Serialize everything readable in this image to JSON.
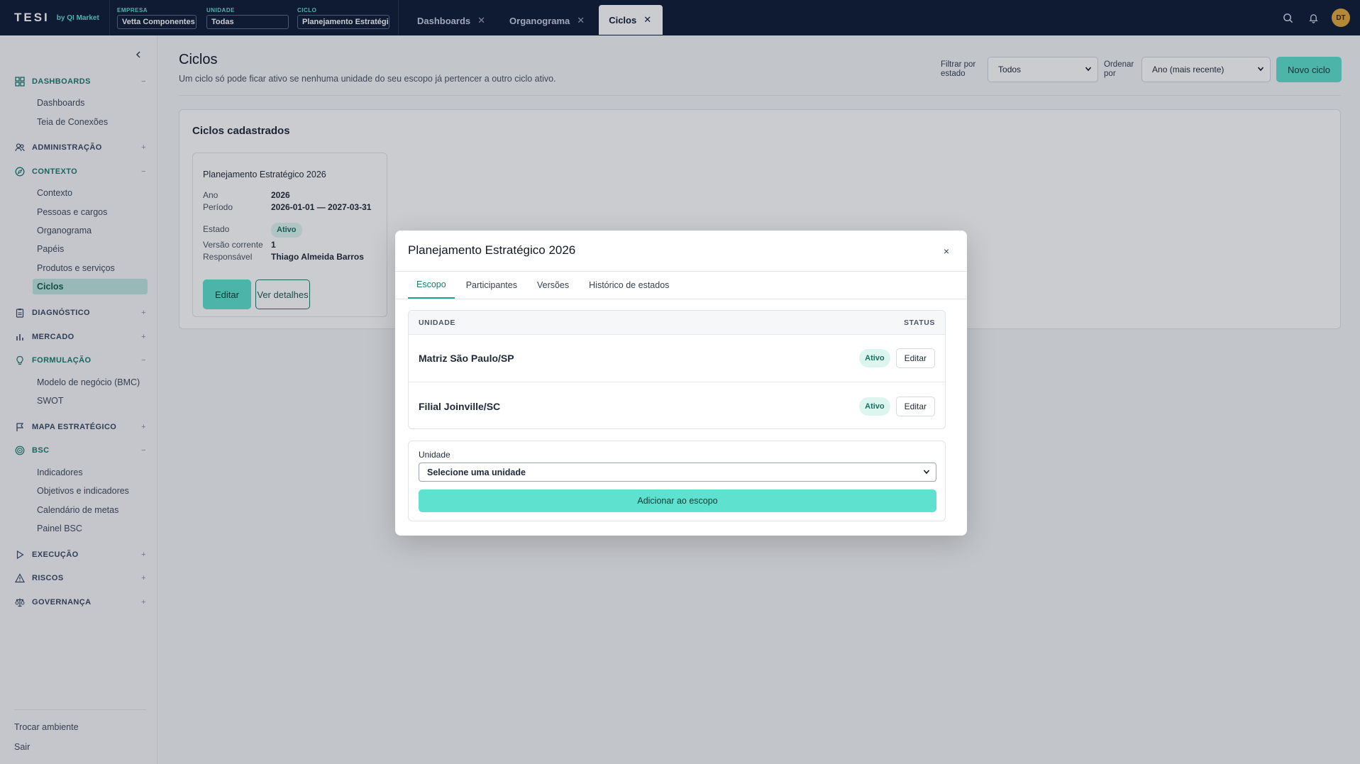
{
  "brand": {
    "logo": "TESI",
    "sub": "by QI Market"
  },
  "context": {
    "empresa": {
      "label": "EMPRESA",
      "value": "Vetta Componentes"
    },
    "unidade": {
      "label": "UNIDADE",
      "value": "Todas"
    },
    "ciclo": {
      "label": "CICLO",
      "value": "Planejamento Estratégi"
    }
  },
  "tabs": [
    {
      "label": "Dashboards"
    },
    {
      "label": "Organograma"
    },
    {
      "label": "Ciclos"
    }
  ],
  "user": {
    "initials": "DT"
  },
  "sidebar": {
    "sections": [
      {
        "label": "DASHBOARDS",
        "sign": "−",
        "items": [
          "Dashboards",
          "Teia de Conexões"
        ]
      },
      {
        "label": "ADMINISTRAÇÃO",
        "sign": "+"
      },
      {
        "label": "CONTEXTO",
        "sign": "−",
        "items": [
          "Contexto",
          "Pessoas e cargos",
          "Organograma",
          "Papéis",
          "Produtos e serviços",
          "Ciclos"
        ]
      },
      {
        "label": "DIAGNÓSTICO",
        "sign": "+"
      },
      {
        "label": "MERCADO",
        "sign": "+"
      },
      {
        "label": "FORMULAÇÃO",
        "sign": "−",
        "items": [
          "Modelo de negócio (BMC)",
          "SWOT"
        ]
      },
      {
        "label": "MAPA ESTRATÉGICO",
        "sign": "+"
      },
      {
        "label": "BSC",
        "sign": "−",
        "items": [
          "Indicadores",
          "Objetivos e indicadores",
          "Calendário de metas",
          "Painel BSC"
        ]
      },
      {
        "label": "EXECUÇÃO",
        "sign": "+"
      },
      {
        "label": "RISCOS",
        "sign": "+"
      },
      {
        "label": "GOVERNANÇA",
        "sign": "+"
      }
    ],
    "bottom": [
      "Trocar ambiente",
      "Sair"
    ]
  },
  "page": {
    "title": "Ciclos",
    "subtitle": "Um ciclo só pode ficar ativo se nenhuma unidade do seu escopo já pertencer a outro ciclo ativo.",
    "filter_label": "Filtrar por estado",
    "filter_value": "Todos",
    "order_label": "Ordenar por",
    "order_value": "Ano (mais recente)",
    "new_button": "Novo ciclo"
  },
  "panel": {
    "title": "Ciclos cadastrados",
    "card": {
      "title": "Planejamento Estratégico 2026",
      "ano_label": "Ano",
      "ano": "2026",
      "periodo_label": "Período",
      "periodo": "2026-01-01 — 2027-03-31",
      "estado_label": "Estado",
      "estado": "Ativo",
      "versao_label": "Versão corrente",
      "versao": "1",
      "resp_label": "Responsável",
      "resp": "Thiago Almeida Barros",
      "edit_button": "Editar",
      "details_button": "Ver detalhes"
    }
  },
  "modal": {
    "title": "Planejamento Estratégico 2026",
    "close": "×",
    "tabs": [
      "Escopo",
      "Participantes",
      "Versões",
      "Histórico de estados"
    ],
    "table": {
      "col_unit": "UNIDADE",
      "col_status": "STATUS",
      "rows": [
        {
          "unit": "Matriz São Paulo/SP",
          "status": "Ativo",
          "action": "Editar"
        },
        {
          "unit": "Filial Joinville/SC",
          "status": "Ativo",
          "action": "Editar"
        }
      ]
    },
    "add": {
      "label": "Unidade",
      "select_value": "Selecione uma unidade",
      "button": "Adicionar ao escopo"
    }
  },
  "colors": {
    "accent": "#5ee1cf",
    "topbar": "#0f1c36",
    "active_text": "#1d7a6e"
  }
}
